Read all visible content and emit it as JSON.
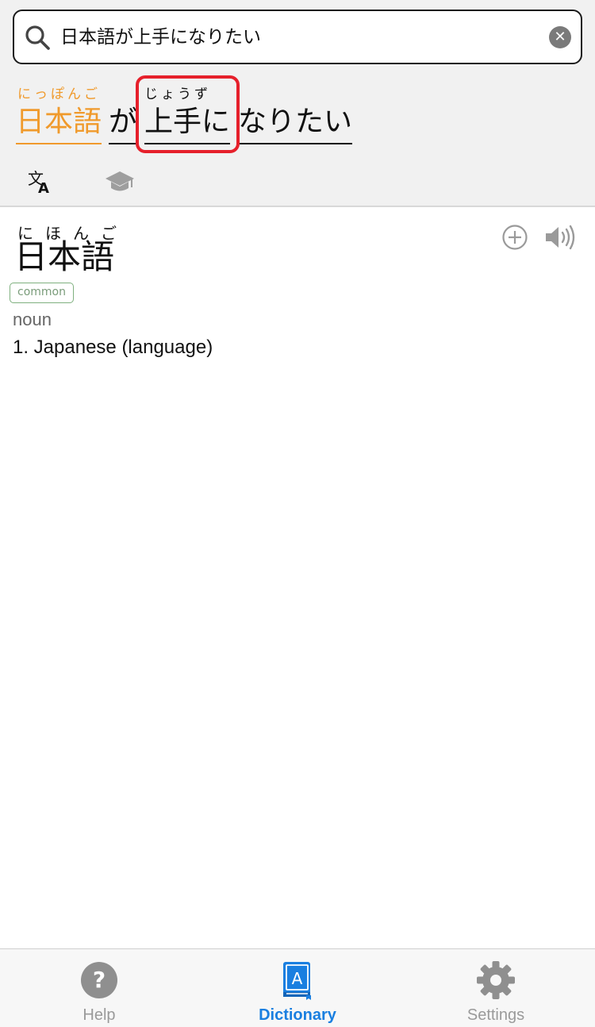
{
  "search": {
    "value": "日本語が上手になりたい",
    "placeholder": ""
  },
  "sentence": {
    "segments": [
      {
        "word": "日本語",
        "reading": "にっぽんご",
        "color": "#f09a2c"
      },
      {
        "word": "が",
        "reading": ""
      },
      {
        "word": "上手に",
        "reading": "じょうず",
        "highlighted": true
      },
      {
        "word": "なりたい",
        "reading": ""
      }
    ]
  },
  "toolbar": {
    "icons": [
      "translate-icon",
      "graduation-cap-icon"
    ]
  },
  "entry": {
    "furigana": "にほんご",
    "headword": "日本語",
    "badge": "common",
    "part_of_speech": "noun",
    "definition": "1. Japanese (language)",
    "actions": [
      "add-icon",
      "speaker-icon"
    ]
  },
  "tabbar": {
    "tabs": [
      {
        "label": "Help",
        "icon": "help-icon",
        "active": false
      },
      {
        "label": "Dictionary",
        "icon": "dictionary-icon",
        "active": true
      },
      {
        "label": "Settings",
        "icon": "gear-icon",
        "active": false
      }
    ]
  },
  "colors": {
    "accent": "#1a7fe0",
    "reading_highlight": "#f09a2c",
    "selection_box": "#e6202b",
    "badge": "#7fb07f"
  }
}
